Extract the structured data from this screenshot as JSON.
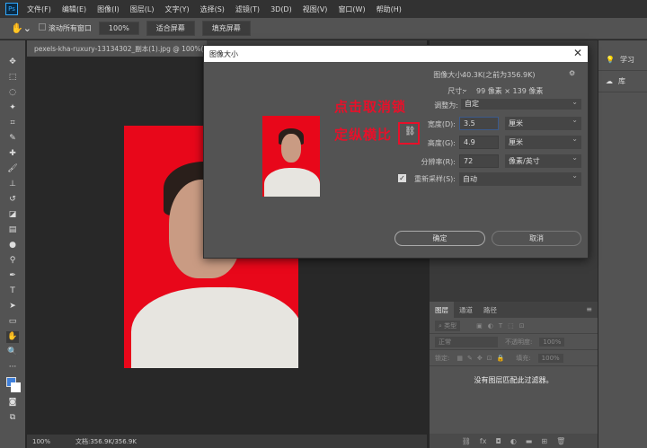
{
  "app": {
    "logo": "Ps"
  },
  "menu": [
    "文件(F)",
    "编辑(E)",
    "图像(I)",
    "图层(L)",
    "文字(Y)",
    "选择(S)",
    "滤镜(T)",
    "3D(D)",
    "视图(V)",
    "窗口(W)",
    "帮助(H)"
  ],
  "options": {
    "tool_icon": "hand-icon",
    "scroll_all": "滚动所有窗口",
    "zoom": "100%",
    "fit_screen": "适合屏幕",
    "fill_screen": "填充屏幕"
  },
  "document": {
    "tab": "pexels-kha-ruxury-13134302_副本(1).jpg @ 100%(RGB/8)",
    "zoom": "100%",
    "doc_size": "文档:356.9K/356.9K"
  },
  "right_panel": {
    "learn": "学习",
    "library": "库"
  },
  "layers": {
    "tabs": [
      "图层",
      "通道",
      "路径"
    ],
    "filter": "类型",
    "blend": "正常",
    "opacity_label": "不透明度:",
    "opacity": "100%",
    "lock_label": "锁定:",
    "fill_label": "填充:",
    "fill": "100%",
    "empty_msg": "没有图层匹配此过滤器。"
  },
  "dialog": {
    "title": "图像大小",
    "image_size_label": "图像大小:",
    "image_size": "40.3K(之前为356.9K)",
    "dims_label": "尺寸:",
    "dims": "99 像素 × 139 像素",
    "fit_label": "调整为:",
    "fit": "自定",
    "width_label": "宽度(D):",
    "width": "3.5",
    "width_unit": "厘米",
    "height_label": "高度(G):",
    "height": "4.9",
    "height_unit": "厘米",
    "res_label": "分辨率(R):",
    "res": "72",
    "res_unit": "像素/英寸",
    "resample_label": "重新采样(S):",
    "resample": "自动",
    "resample_checked": true,
    "ok": "确定",
    "cancel": "取消"
  },
  "annotation": {
    "line1": "点击取消锁",
    "line2": "定纵横比",
    "color": "#e8102a"
  }
}
